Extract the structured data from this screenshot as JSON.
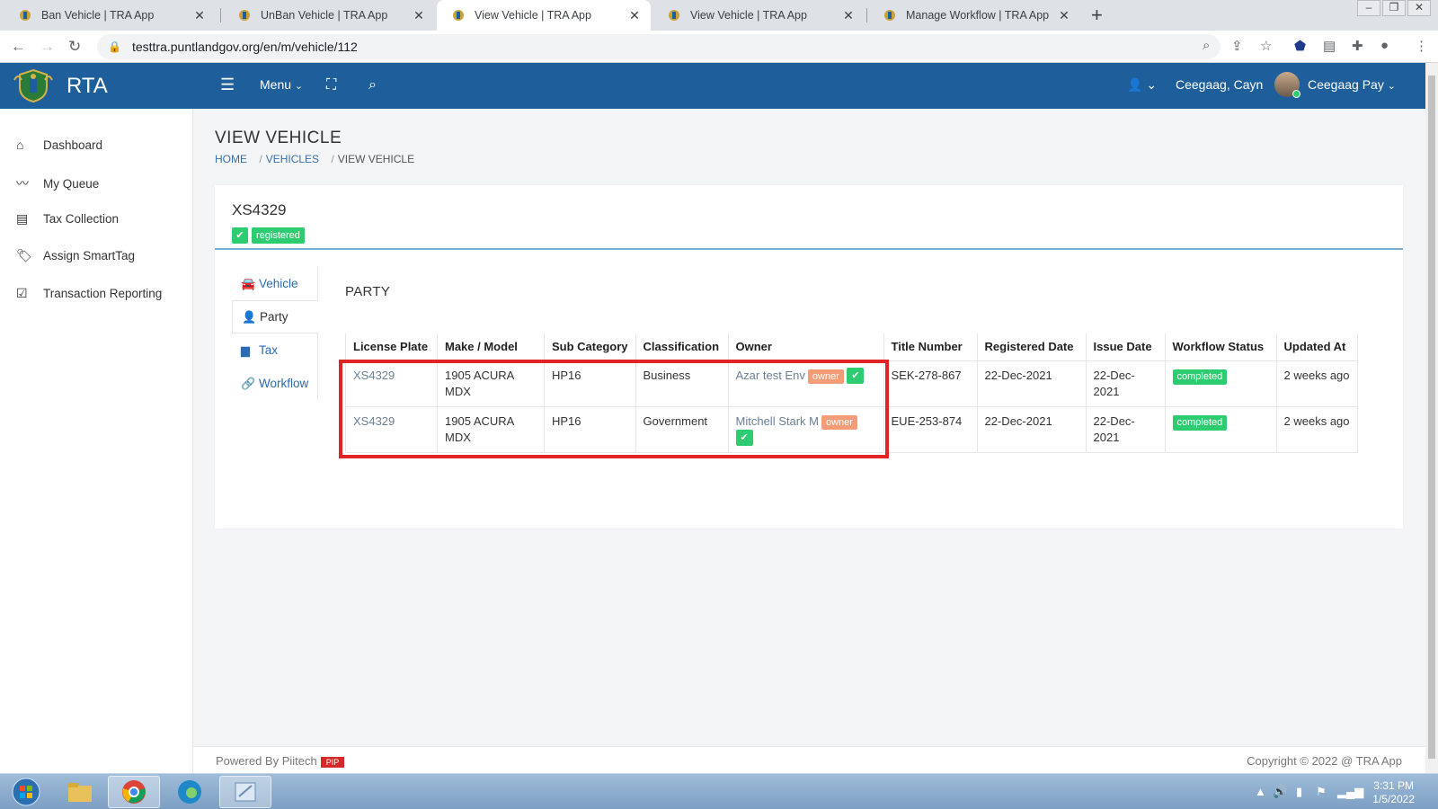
{
  "browser": {
    "tabs": [
      {
        "title": "Ban Vehicle | TRA App",
        "active": false
      },
      {
        "title": "UnBan Vehicle | TRA App",
        "active": false
      },
      {
        "title": "View Vehicle | TRA App",
        "active": true
      },
      {
        "title": "View Vehicle | TRA App",
        "active": false
      },
      {
        "title": "Manage Workflow | TRA App",
        "active": false
      }
    ],
    "url": "testtra.puntlandgov.org/en/m/vehicle/112"
  },
  "header": {
    "brand": "RTA",
    "menu_label": "Menu",
    "user_short": "Ceegaag, Cayn",
    "user_name": "Ceegaag Pay"
  },
  "sidebar": {
    "items": [
      {
        "label": "Dashboard",
        "icon": "home-icon"
      },
      {
        "label": "My Queue",
        "icon": "trend-icon"
      },
      {
        "label": "Tax Collection",
        "icon": "list-icon"
      },
      {
        "label": "Assign SmartTag",
        "icon": "tags-icon"
      },
      {
        "label": "Transaction Reporting",
        "icon": "checkbox-icon"
      }
    ]
  },
  "page": {
    "title": "VIEW VEHICLE",
    "breadcrumb": [
      "HOME",
      "VEHICLES",
      "VIEW VEHICLE"
    ]
  },
  "vehicle": {
    "plate": "XS4329",
    "status": "registered"
  },
  "vtabs": [
    {
      "label": "Vehicle",
      "icon": "car-icon"
    },
    {
      "label": "Party",
      "icon": "user-icon"
    },
    {
      "label": "Tax",
      "icon": "file-icon"
    },
    {
      "label": "Workflow",
      "icon": "link-icon"
    }
  ],
  "party": {
    "section_title": "PARTY",
    "columns": [
      "License Plate",
      "Make / Model",
      "Sub Category",
      "Classification",
      "Owner",
      "Title Number",
      "Registered Date",
      "Issue Date",
      "Workflow Status",
      "Updated At"
    ],
    "rows": [
      {
        "plate": "XS4329",
        "make_model": "1905 ACURA MDX",
        "sub_category": "HP16",
        "classification": "Business",
        "owner": "Azar test Env",
        "owner_role": "owner",
        "title_number": "SEK-278-867",
        "registered_date": "22-Dec-2021",
        "issue_date": "22-Dec-2021",
        "workflow_status": "completed",
        "updated_at": "2 weeks ago"
      },
      {
        "plate": "XS4329",
        "make_model": "1905 ACURA MDX",
        "sub_category": "HP16",
        "classification": "Government",
        "owner": "Mitchell Stark M",
        "owner_role": "owner",
        "title_number": "EUE-253-874",
        "registered_date": "22-Dec-2021",
        "issue_date": "22-Dec-2021",
        "workflow_status": "completed",
        "updated_at": "2 weeks ago"
      }
    ]
  },
  "footer": {
    "powered": "Powered By Piitech",
    "badge": "PIP",
    "copyright": "Copyright © 2022 @ TRA App"
  },
  "taskbar": {
    "time": "3:31 PM",
    "date": "1/5/2022"
  },
  "colors": {
    "header": "#1e5f9b",
    "success": "#2ecc71",
    "owner_badge": "#f39c77",
    "highlight": "#e02424"
  }
}
